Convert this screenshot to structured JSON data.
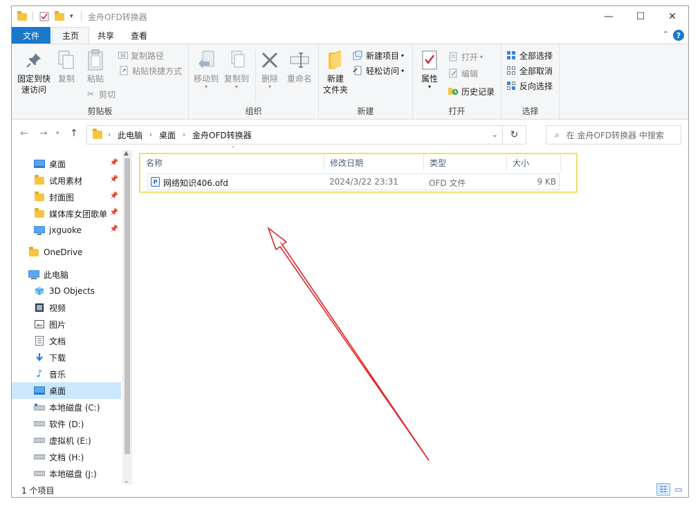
{
  "titlebar": {
    "title": "金舟OFD转换器",
    "minimize": "—",
    "maximize": "☐",
    "close": "✕"
  },
  "ribbon_tabs": [
    {
      "label": "文件"
    },
    {
      "label": "主页"
    },
    {
      "label": "共享"
    },
    {
      "label": "查看"
    }
  ],
  "help_label": "?",
  "clipboard": {
    "pin_quick_line1": "固定到快",
    "pin_quick_line2": "速访问",
    "copy": "复制",
    "paste": "粘贴",
    "copy_path": "复制路径",
    "paste_shortcut": "粘贴快捷方式",
    "cut": "剪切",
    "label": "剪贴板"
  },
  "organize": {
    "move_to": "移动到",
    "copy_to": "复制到",
    "delete": "删除",
    "rename": "重命名",
    "label": "组织"
  },
  "new_group": {
    "new_folder_line1": "新建",
    "new_folder_line2": "文件夹",
    "new_item": "新建项目",
    "easy_access": "轻松访问",
    "label": "新建"
  },
  "open_group": {
    "properties": "属性",
    "open": "打开",
    "edit": "编辑",
    "history": "历史记录",
    "label": "打开"
  },
  "select_group": {
    "select_all": "全部选择",
    "select_none": "全部取消",
    "invert": "反向选择",
    "label": "选择"
  },
  "address": {
    "crumbs": [
      "此电脑",
      "桌面",
      "金舟OFD转换器"
    ]
  },
  "search": {
    "placeholder": "在 金舟OFD转换器 中搜索"
  },
  "nav_pane": {
    "quick_access": [
      {
        "label": "桌面",
        "icon": "desktop-icon"
      },
      {
        "label": "试用素材",
        "icon": "folder-icon"
      },
      {
        "label": "封面图",
        "icon": "folder-icon"
      },
      {
        "label": "媒体库女团歌单",
        "icon": "folder-icon"
      },
      {
        "label": "jxguoke",
        "icon": "monitor-icon"
      }
    ],
    "onedrive": "OneDrive",
    "this_pc": "此电脑",
    "pc_items": [
      {
        "label": "3D Objects",
        "icon": "cube-icon"
      },
      {
        "label": "视频",
        "icon": "video-icon"
      },
      {
        "label": "图片",
        "icon": "picture-icon"
      },
      {
        "label": "文档",
        "icon": "document-icon"
      },
      {
        "label": "下载",
        "icon": "download-icon"
      },
      {
        "label": "音乐",
        "icon": "music-icon"
      },
      {
        "label": "桌面",
        "icon": "desktop-icon"
      },
      {
        "label": "本地磁盘 (C:)",
        "icon": "drive-icon"
      },
      {
        "label": "软件 (D:)",
        "icon": "drive-icon"
      },
      {
        "label": "虚拟机 (E:)",
        "icon": "drive-icon"
      },
      {
        "label": "文档 (H:)",
        "icon": "drive-icon"
      },
      {
        "label": "本地磁盘 (J:)",
        "icon": "drive-icon"
      }
    ]
  },
  "file_list": {
    "columns": [
      "名称",
      "修改日期",
      "类型",
      "大小"
    ],
    "rows": [
      {
        "name": "网络知识406.ofd",
        "modified": "2024/3/22 23:31",
        "type": "OFD 文件",
        "size": "9 KB"
      }
    ]
  },
  "status_bar": {
    "count": "1 个项目"
  },
  "colors": {
    "accent": "#1979ca",
    "selection": "#cce8ff",
    "highlight_border": "#f2de69",
    "arrow": "#e0262a"
  }
}
